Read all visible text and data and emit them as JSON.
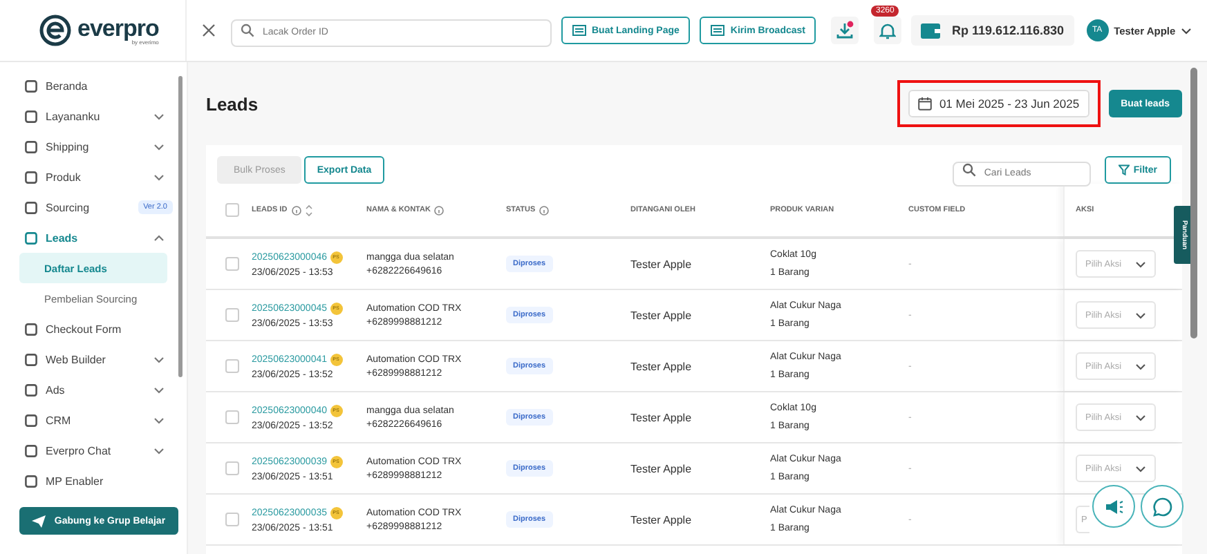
{
  "header": {
    "logo": "everpro",
    "logo_sub": "by everimo",
    "search": {
      "placeholder": "Lacak Order ID"
    },
    "buttons": [
      "Buat Landing Page",
      "Kirim Broadcast"
    ],
    "notification_count": "3260",
    "balance": "Rp 119.612.116.830",
    "user": {
      "initials": "TA",
      "name": "Tester Apple"
    }
  },
  "sidebar": {
    "items": [
      {
        "label": "Beranda",
        "expandable": false,
        "selected": false
      },
      {
        "label": "Layananku",
        "expandable": true,
        "expanded": false,
        "selected": false
      },
      {
        "label": "Shipping",
        "expandable": true,
        "expanded": false,
        "selected": false
      },
      {
        "label": "Produk",
        "expandable": true,
        "expanded": false,
        "selected": false
      },
      {
        "label": "Sourcing",
        "expandable": false,
        "selected": false,
        "badge": "Ver 2.0"
      },
      {
        "label": "Leads",
        "expandable": true,
        "expanded": true,
        "selected": true,
        "children": [
          {
            "label": "Daftar Leads",
            "selected": true
          },
          {
            "label": "Pembelian Sourcing",
            "selected": false
          }
        ]
      },
      {
        "label": "Checkout Form",
        "expandable": false,
        "selected": false
      },
      {
        "label": "Web Builder",
        "expandable": true,
        "expanded": false,
        "selected": false
      },
      {
        "label": "Ads",
        "expandable": true,
        "expanded": false,
        "selected": false
      },
      {
        "label": "CRM",
        "expandable": true,
        "expanded": false,
        "selected": false
      },
      {
        "label": "Everpro Chat",
        "expandable": true,
        "expanded": false,
        "selected": false
      },
      {
        "label": "MP Enabler",
        "expandable": false,
        "selected": false
      }
    ],
    "join_button": "Gabung ke Grup Belajar"
  },
  "page": {
    "title": "Leads",
    "date_range": "01 Mei 2025 - 23 Jun 2025",
    "create_button": "Buat leads",
    "guide_tab": "Panduan"
  },
  "toolbar": {
    "buttons": [
      {
        "label": "Bulk Proses",
        "disabled": true
      },
      {
        "label": "Export Data",
        "disabled": false
      }
    ],
    "search": {
      "placeholder": "Cari Leads"
    },
    "filter": "Filter"
  },
  "table": {
    "all_checked": false,
    "columns": [
      "LEADS ID",
      "NAMA & KONTAK",
      "STATUS",
      "DITANGANI OLEH",
      "PRODUK VARIAN",
      "CUSTOM FIELD",
      "AKSI"
    ],
    "rows": [
      {
        "checked": false,
        "id": "20250623000046",
        "tag": "PS",
        "date": "23/06/2025 - 13:53",
        "name": "mangga dua selatan",
        "phone": "+6282226649616",
        "status": "Diproses",
        "handler": "Tester Apple",
        "product": "Coklat 10g",
        "qty": "1 Barang",
        "custom": "-",
        "action": "Pilih Aksi"
      },
      {
        "checked": false,
        "id": "20250623000045",
        "tag": "PS",
        "date": "23/06/2025 - 13:53",
        "name": "Automation COD TRX",
        "phone": "+6289998881212",
        "status": "Diproses",
        "handler": "Tester Apple",
        "product": "Alat Cukur Naga",
        "qty": "1 Barang",
        "custom": "-",
        "action": "Pilih Aksi"
      },
      {
        "checked": false,
        "id": "20250623000041",
        "tag": "PS",
        "date": "23/06/2025 - 13:52",
        "name": "Automation COD TRX",
        "phone": "+6289998881212",
        "status": "Diproses",
        "handler": "Tester Apple",
        "product": "Alat Cukur Naga",
        "qty": "1 Barang",
        "custom": "-",
        "action": "Pilih Aksi"
      },
      {
        "checked": false,
        "id": "20250623000040",
        "tag": "PS",
        "date": "23/06/2025 - 13:52",
        "name": "mangga dua selatan",
        "phone": "+6282226649616",
        "status": "Diproses",
        "handler": "Tester Apple",
        "product": "Coklat 10g",
        "qty": "1 Barang",
        "custom": "-",
        "action": "Pilih Aksi"
      },
      {
        "checked": false,
        "id": "20250623000039",
        "tag": "PS",
        "date": "23/06/2025 - 13:51",
        "name": "Automation COD TRX",
        "phone": "+6289998881212",
        "status": "Diproses",
        "handler": "Tester Apple",
        "product": "Alat Cukur Naga",
        "qty": "1 Barang",
        "custom": "-",
        "action": "Pilih Aksi"
      },
      {
        "checked": false,
        "id": "20250623000035",
        "tag": "PS",
        "date": "23/06/2025 - 13:51",
        "name": "Automation COD TRX",
        "phone": "+6289998881212",
        "status": "Diproses",
        "handler": "Tester Apple",
        "product": "Alat Cukur Naga",
        "qty": "1 Barang",
        "custom": "-",
        "action": "P",
        "action_covered": true
      }
    ]
  }
}
